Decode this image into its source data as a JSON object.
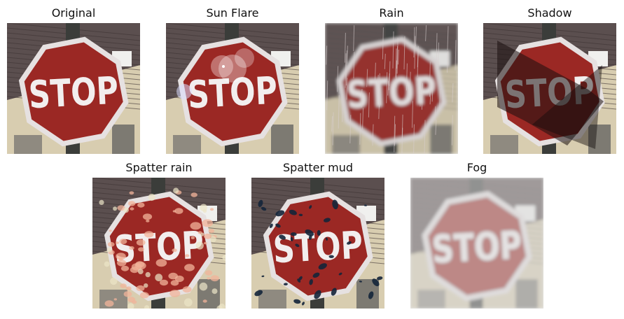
{
  "panels": [
    {
      "id": "original",
      "title": "Original",
      "effect": "none"
    },
    {
      "id": "sun-flare",
      "title": "Sun Flare",
      "effect": "sun-flare"
    },
    {
      "id": "rain",
      "title": "Rain",
      "effect": "rain"
    },
    {
      "id": "shadow",
      "title": "Shadow",
      "effect": "shadow"
    },
    {
      "id": "spatter-rain",
      "title": "Spatter rain",
      "effect": "spatter-rain"
    },
    {
      "id": "spatter-mud",
      "title": "Spatter mud",
      "effect": "spatter-mud"
    },
    {
      "id": "fog",
      "title": "Fog",
      "effect": "fog"
    }
  ],
  "sign": {
    "text": "STOP",
    "face_color": "#9b2824",
    "border_color": "#e6e1e1",
    "roof_color": "#5b4f4f",
    "wall_color": "#d8cdb0",
    "pole_color": "#3b3d3a"
  }
}
